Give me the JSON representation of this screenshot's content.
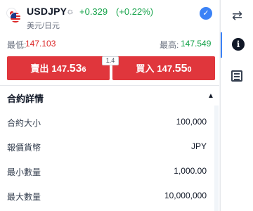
{
  "header": {
    "symbol": "USDJPY",
    "market_icon": "sun-icon",
    "change": "+0.329",
    "change_pct": "(+0.22%)",
    "subtitle": "美元/日元",
    "verified_icon": "check-badge-icon"
  },
  "range": {
    "low_label": "最低:",
    "low_value": "147.103",
    "high_label": "最高:",
    "high_value": "147.549"
  },
  "trade": {
    "sell_label": "賣出",
    "sell_price_main": "147.",
    "sell_price_big": "53",
    "sell_price_small": "6",
    "buy_label": "買入",
    "buy_price_main": "147.",
    "buy_price_big": "55",
    "buy_price_small": "0",
    "spread": "1.4"
  },
  "contract": {
    "title": "合約詳情",
    "rows": [
      {
        "key": "合約大小",
        "value": "100,000"
      },
      {
        "key": "報價貨幣",
        "value": "JPY"
      },
      {
        "key": "最小數量",
        "value": "1,000.00"
      },
      {
        "key": "最大數量",
        "value": "10,000,000"
      }
    ]
  },
  "rail": {
    "items": [
      {
        "icon": "swap-arrows-icon",
        "glyph": "⇄"
      },
      {
        "icon": "info-icon",
        "glyph": "i"
      },
      {
        "icon": "news-icon",
        "glyph": ""
      }
    ]
  },
  "colors": {
    "sell_button": "#e0363c",
    "buy_button": "#e0363c",
    "positive": "#16a34a",
    "negative": "#dc2626",
    "accent": "#3b82f6"
  }
}
